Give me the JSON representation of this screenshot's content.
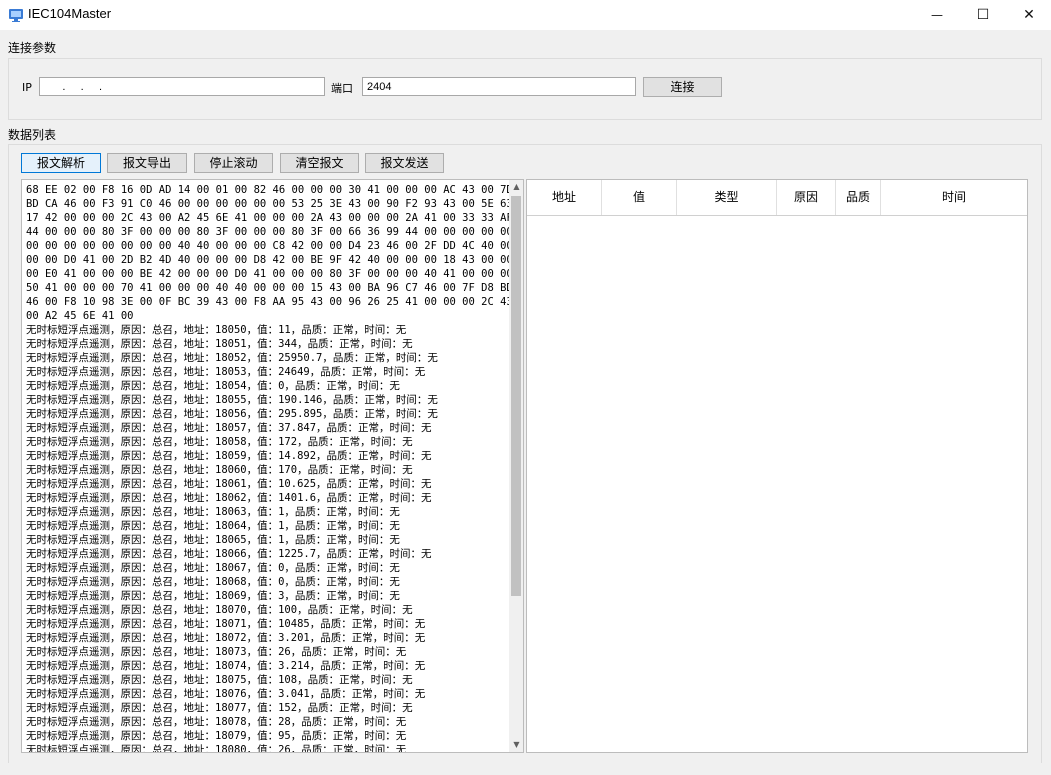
{
  "window": {
    "title": "IEC104Master",
    "minimize_glyph": "—",
    "maximize_glyph": "☐",
    "close_glyph": "✕"
  },
  "connection": {
    "group_title": "连接参数",
    "ip_label": "IP",
    "ip_value": "      .     .     .",
    "port_label": "端口",
    "port_value": "2404",
    "connect_button": "连接"
  },
  "data_list": {
    "group_title": "数据列表",
    "buttons": [
      "报文解析",
      "报文导出",
      "停止滚动",
      "清空报文",
      "报文发送"
    ]
  },
  "message_log": [
    "68 EE 02 00 F8 16 0D AD 14 00 01 00 82 46 00 00 00 30 41 00 00 00 AC 43 00 7D",
    "BD CA 46 00 F3 91 C0 46 00 00 00 00 00 00 53 25 3E 43 00 90 F2 93 43 00 5E 63",
    "17 42 00 00 00 2C 43 00 A2 45 6E 41 00 00 00 2A 43 00 00 00 2A 41 00 33 33 AF",
    "44 00 00 00 80 3F 00 00 00 80 3F 00 00 00 80 3F 00 66 36 99 44 00 00 00 00 00",
    "00 00 00 00 00 00 00 00 40 40 00 00 00 C8 42 00 00 D4 23 46 00 2F DD 4C 40 00",
    "00 00 D0 41 00 2D B2 4D 40 00 00 00 D8 42 00 BE 9F 42 40 00 00 00 18 43 00 00",
    "00 E0 41 00 00 00 BE 42 00 00 00 D0 41 00 00 00 80 3F 00 00 00 40 41 00 00 00",
    "50 41 00 00 00 70 41 00 00 00 40 40 00 00 00 15 43 00 BA 96 C7 46 00 7F D8 BD",
    "46 00 F8 10 98 3E 00 0F BC 39 43 00 F8 AA 95 43 00 96 26 25 41 00 00 00 2C 43",
    "00 A2 45 6E 41 00",
    "无时标短浮点遥测，原因：总召，地址：18050，值：11，品质：正常，时间：无",
    "无时标短浮点遥测，原因：总召，地址：18051，值：344，品质：正常，时间：无",
    "无时标短浮点遥测，原因：总召，地址：18052，值：25950.7，品质：正常，时间：无",
    "无时标短浮点遥测，原因：总召，地址：18053，值：24649，品质：正常，时间：无",
    "无时标短浮点遥测，原因：总召，地址：18054，值：0，品质：正常，时间：无",
    "无时标短浮点遥测，原因：总召，地址：18055，值：190.146，品质：正常，时间：无",
    "无时标短浮点遥测，原因：总召，地址：18056，值：295.895，品质：正常，时间：无",
    "无时标短浮点遥测，原因：总召，地址：18057，值：37.847，品质：正常，时间：无",
    "无时标短浮点遥测，原因：总召，地址：18058，值：172，品质：正常，时间：无",
    "无时标短浮点遥测，原因：总召，地址：18059，值：14.892，品质：正常，时间：无",
    "无时标短浮点遥测，原因：总召，地址：18060，值：170，品质：正常，时间：无",
    "无时标短浮点遥测，原因：总召，地址：18061，值：10.625，品质：正常，时间：无",
    "无时标短浮点遥测，原因：总召，地址：18062，值：1401.6，品质：正常，时间：无",
    "无时标短浮点遥测，原因：总召，地址：18063，值：1，品质：正常，时间：无",
    "无时标短浮点遥测，原因：总召，地址：18064，值：1，品质：正常，时间：无",
    "无时标短浮点遥测，原因：总召，地址：18065，值：1，品质：正常，时间：无",
    "无时标短浮点遥测，原因：总召，地址：18066，值：1225.7，品质：正常，时间：无",
    "无时标短浮点遥测，原因：总召，地址：18067，值：0，品质：正常，时间：无",
    "无时标短浮点遥测，原因：总召，地址：18068，值：0，品质：正常，时间：无",
    "无时标短浮点遥测，原因：总召，地址：18069，值：3，品质：正常，时间：无",
    "无时标短浮点遥测，原因：总召，地址：18070，值：100，品质：正常，时间：无",
    "无时标短浮点遥测，原因：总召，地址：18071，值：10485，品质：正常，时间：无",
    "无时标短浮点遥测，原因：总召，地址：18072，值：3.201，品质：正常，时间：无",
    "无时标短浮点遥测，原因：总召，地址：18073，值：26，品质：正常，时间：无",
    "无时标短浮点遥测，原因：总召，地址：18074，值：3.214，品质：正常，时间：无",
    "无时标短浮点遥测，原因：总召，地址：18075，值：108，品质：正常，时间：无",
    "无时标短浮点遥测，原因：总召，地址：18076，值：3.041，品质：正常，时间：无",
    "无时标短浮点遥测，原因：总召，地址：18077，值：152，品质：正常，时间：无",
    "无时标短浮点遥测，原因：总召，地址：18078，值：28，品质：正常，时间：无",
    "无时标短浮点遥测，原因：总召，地址：18079，值：95，品质：正常，时间：无",
    "无时标短浮点遥测，原因：总召，地址：18080，值：26，品质：正常，时间：无"
  ],
  "table": {
    "columns": [
      "地址",
      "值",
      "类型",
      "原因",
      "品质",
      "时间"
    ],
    "rows": []
  },
  "colors": {
    "window_bg": "#f0f0f0",
    "accent": "#0078d7"
  }
}
